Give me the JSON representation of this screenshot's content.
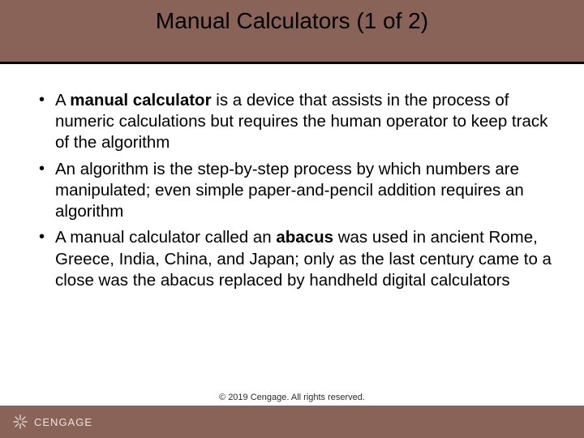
{
  "header": {
    "title": "Manual Calculators (1 of 2)"
  },
  "bullets": [
    {
      "prefix": "A ",
      "bold": "manual calculator",
      "rest": " is a device that assists in the process of numeric calculations but requires the human operator to keep track of the algorithm"
    },
    {
      "prefix": "",
      "bold": "",
      "rest": "An algorithm is the step-by-step process by which numbers are manipulated; even simple paper-and-pencil addition requires an algorithm"
    },
    {
      "prefix": "A manual calculator called an ",
      "bold": "abacus",
      "rest": " was used in ancient Rome, Greece, India, China, and Japan; only as the last century came to a close was the abacus replaced by handheld digital calculators"
    }
  ],
  "footer": {
    "brand": "CENGAGE",
    "copyright": "© 2019 Cengage. All rights reserved."
  }
}
